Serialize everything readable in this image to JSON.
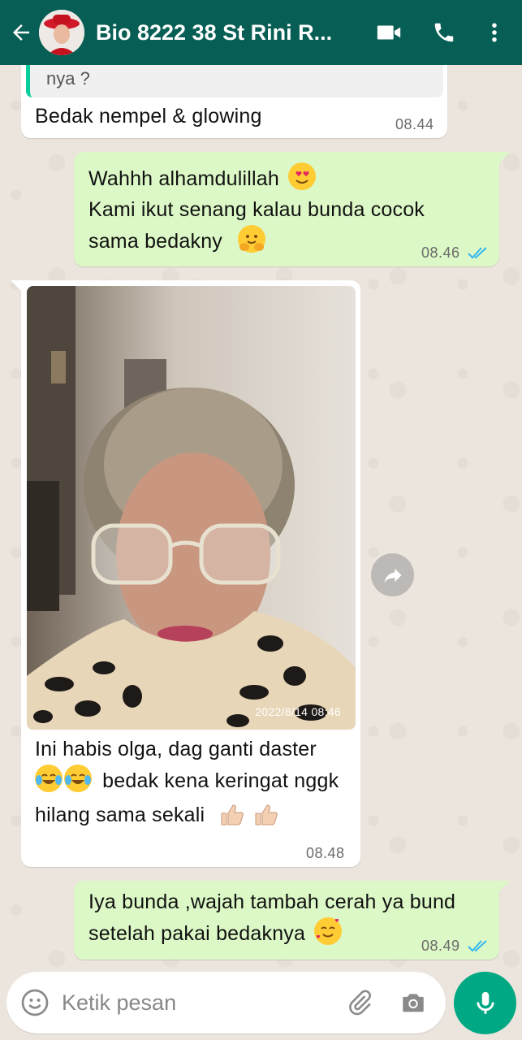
{
  "header": {
    "title": "Bio 8222 38 St Rini R...",
    "back_icon": "arrow-left-icon",
    "video_icon": "video-call-icon",
    "call_icon": "phone-icon",
    "menu_icon": "more-vert-icon",
    "bg_color": "#075e54"
  },
  "messages": [
    {
      "type": "in",
      "quote_fragment": "nya ?",
      "text": "Bedak nempel & glowing",
      "time": "08.44"
    },
    {
      "type": "out",
      "lines": [
        "Wahhh alhamdulillah",
        "Kami ikut senang kalau bunda cocok",
        "sama bedakny"
      ],
      "time": "08.46",
      "status": "read"
    },
    {
      "type": "in",
      "image_timestamp": "2022/8/14 08:46",
      "lines": [
        "Ini habis olga, dag ganti daster",
        "bedak kena keringat nggk",
        "hilang sama sekali"
      ],
      "time": "08.48"
    },
    {
      "type": "out",
      "lines": [
        "Iya bunda ,wajah tambah cerah ya bund",
        "setelah pakai bedaknya"
      ],
      "time": "08.49",
      "status": "read"
    }
  ],
  "input": {
    "placeholder": "Ketik pesan",
    "emoji_icon": "emoji-icon",
    "attach_icon": "paperclip-icon",
    "camera_icon": "camera-icon",
    "mic_icon": "mic-icon"
  },
  "colors": {
    "incoming_bubble": "#ffffff",
    "outgoing_bubble": "#dcf8c6",
    "read_tick": "#34b7f1",
    "accent": "#00a884"
  }
}
